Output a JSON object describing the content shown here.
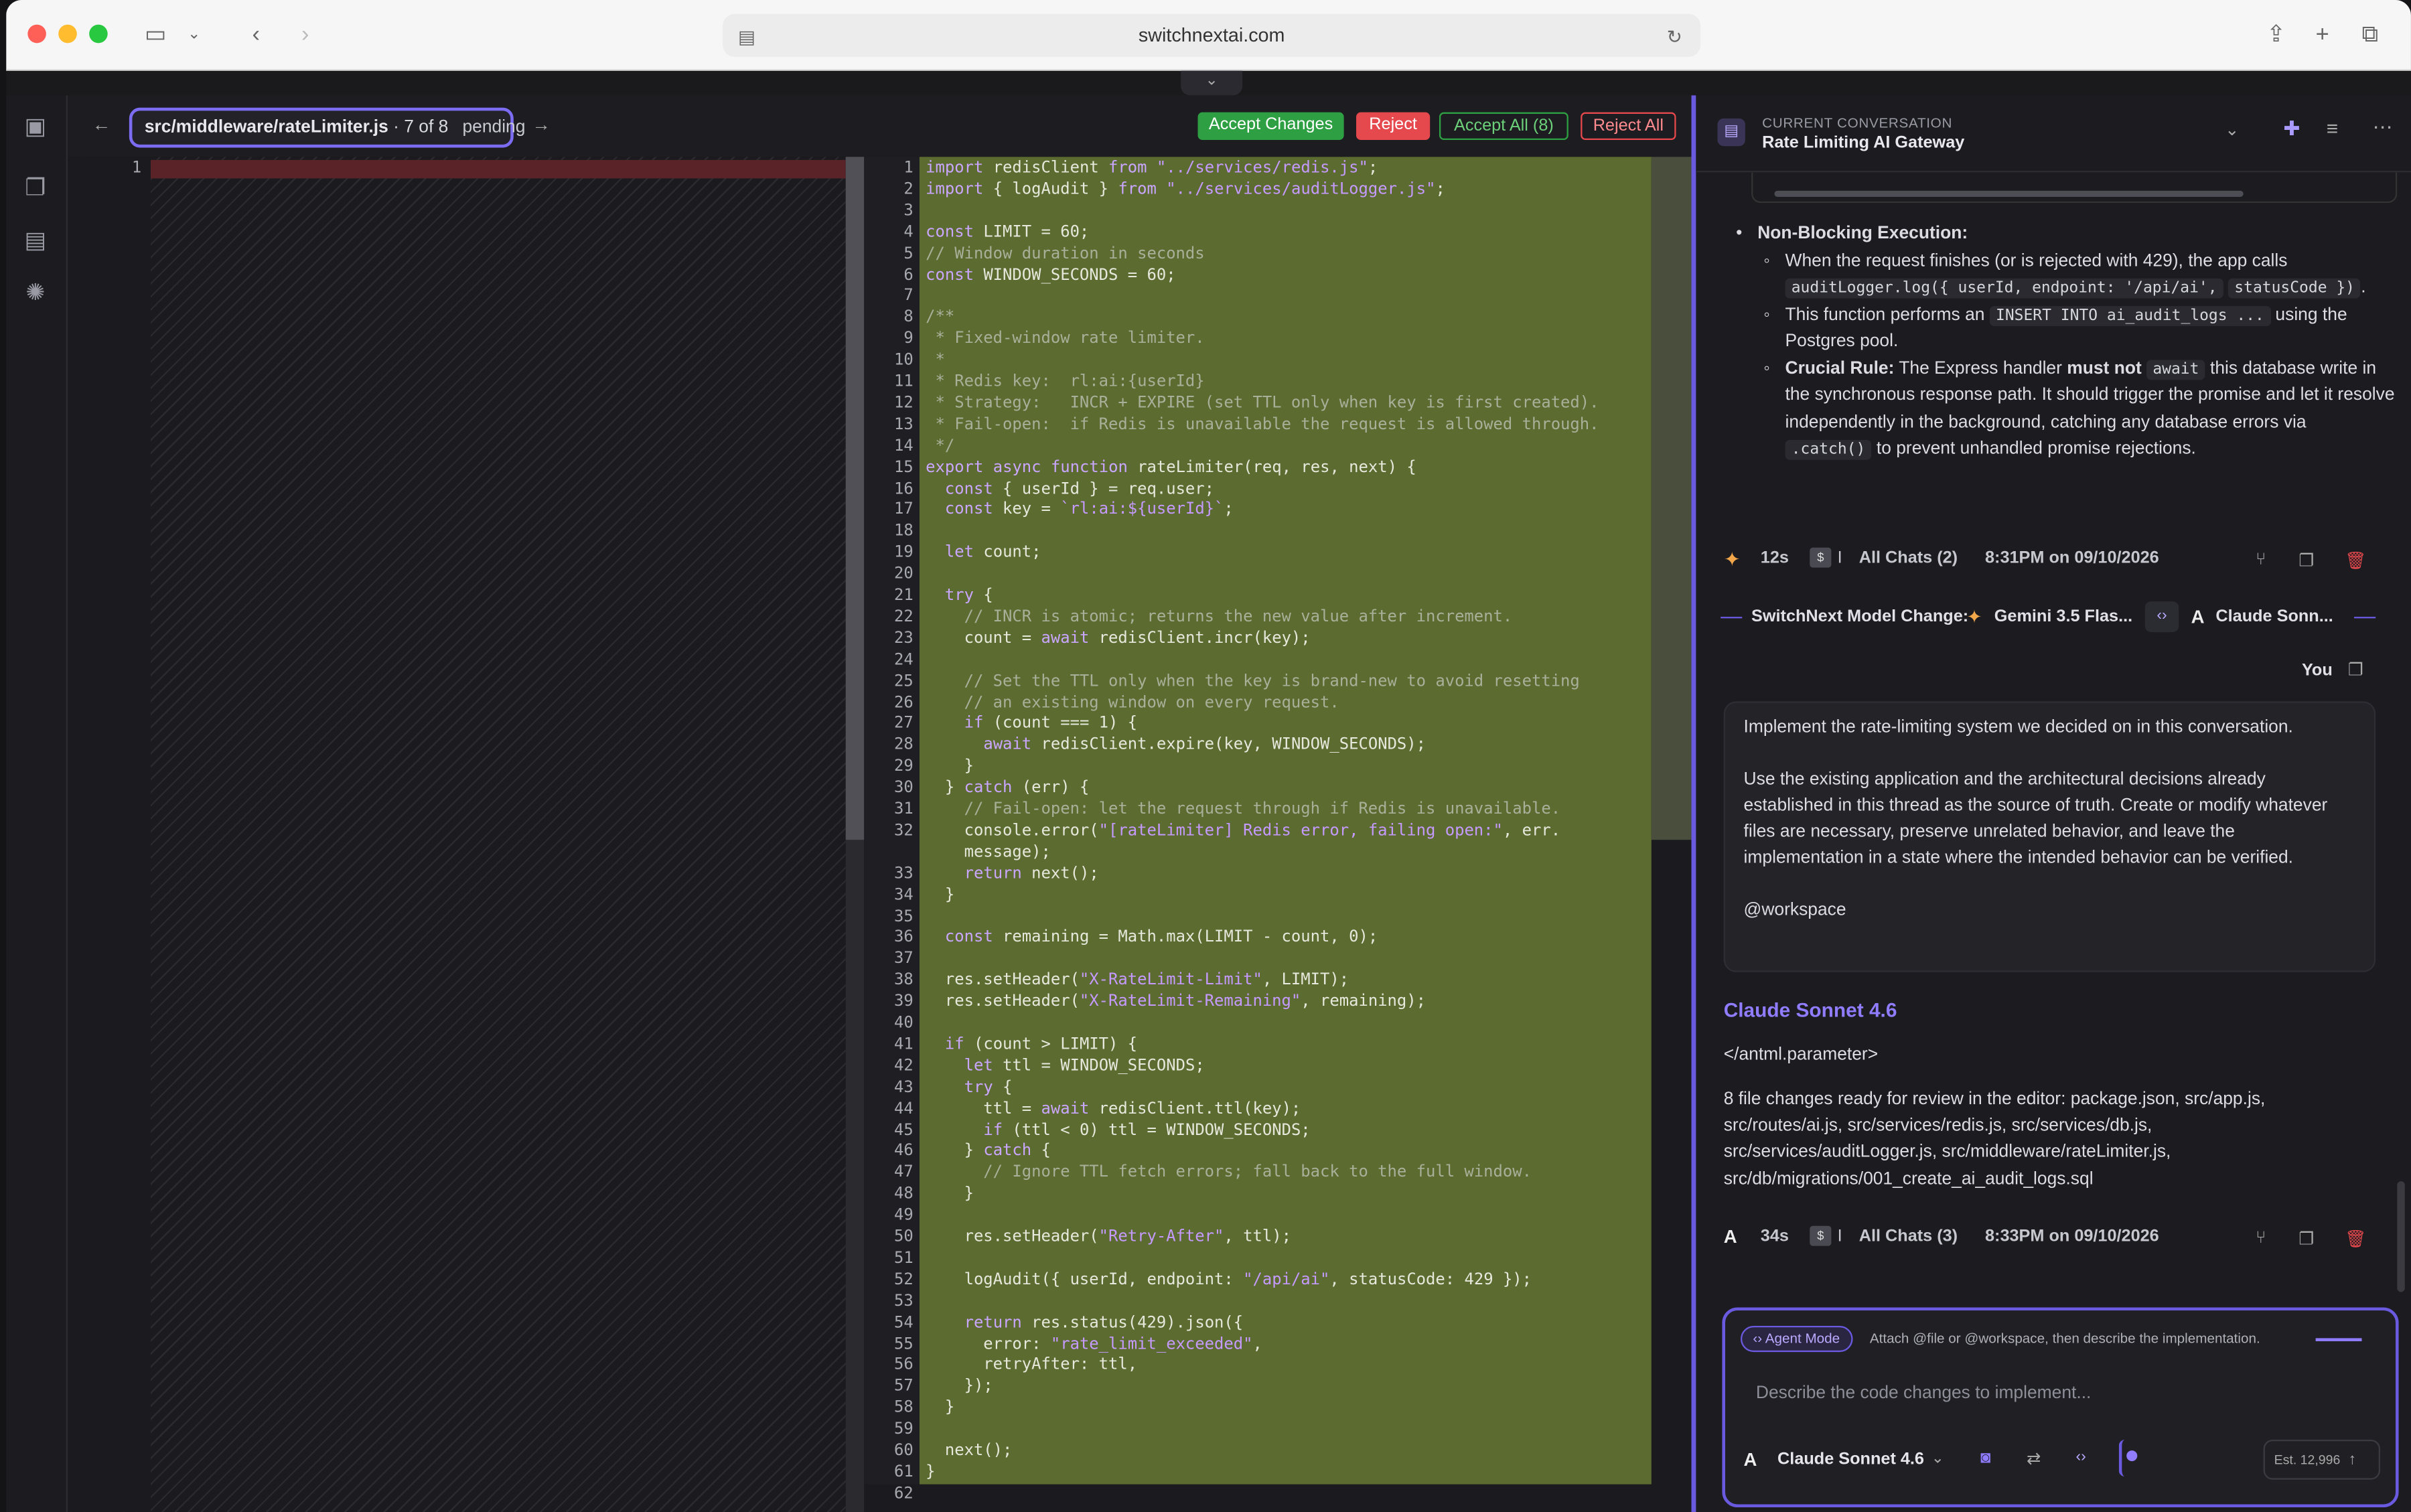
{
  "browser": {
    "url": "switchnextai.com"
  },
  "toolbar": {
    "file_path": "src/middleware/rateLimiter.js",
    "file_position": " · 7 of 8",
    "file_status": "pending",
    "accept_changes": "Accept Changes",
    "reject": "Reject",
    "accept_all": "Accept All (8)",
    "reject_all": "Reject All"
  },
  "left_pane": {
    "line_number": "1"
  },
  "code_lines": [
    "import redisClient from \"../services/redis.js\";",
    "import { logAudit } from \"../services/auditLogger.js\";",
    "",
    "const LIMIT = 60;",
    "// Window duration in seconds",
    "const WINDOW_SECONDS = 60;",
    "",
    "/**",
    " * Fixed-window rate limiter.",
    " *",
    " * Redis key:  rl:ai:{userId}",
    " * Strategy:   INCR + EXPIRE (set TTL only when key is first created).",
    " * Fail-open:  if Redis is unavailable the request is allowed through.",
    " */",
    "export async function rateLimiter(req, res, next) {",
    "  const { userId } = req.user;",
    "  const key = `rl:ai:${userId}`;",
    "",
    "  let count;",
    "",
    "  try {",
    "    // INCR is atomic; returns the new value after increment.",
    "    count = await redisClient.incr(key);",
    "",
    "    // Set the TTL only when the key is brand-new to avoid resetting",
    "    // an existing window on every request.",
    "    if (count === 1) {",
    "      await redisClient.expire(key, WINDOW_SECONDS);",
    "    }",
    "  } catch (err) {",
    "    // Fail-open: let the request through if Redis is unavailable.",
    "    console.error(\"[rateLimiter] Redis error, failing open:\", err.",
    "    message);",
    "    return next();",
    "  }",
    "",
    "  const remaining = Math.max(LIMIT - count, 0);",
    "",
    "  res.setHeader(\"X-RateLimit-Limit\", LIMIT);",
    "  res.setHeader(\"X-RateLimit-Remaining\", remaining);",
    "",
    "  if (count > LIMIT) {",
    "    let ttl = WINDOW_SECONDS;",
    "    try {",
    "      ttl = await redisClient.ttl(key);",
    "      if (ttl < 0) ttl = WINDOW_SECONDS;",
    "    } catch {",
    "      // Ignore TTL fetch errors; fall back to the full window.",
    "    }",
    "",
    "    res.setHeader(\"Retry-After\", ttl);",
    "",
    "    logAudit({ userId, endpoint: \"/api/ai\", statusCode: 429 });",
    "",
    "    return res.status(429).json({",
    "      error: \"rate_limit_exceeded\",",
    "      retryAfter: ttl,",
    "    });",
    "  }",
    "",
    "  next();",
    "}",
    ""
  ],
  "line_numbers": [
    "1",
    "2",
    "3",
    "4",
    "5",
    "6",
    "7",
    "8",
    "9",
    "10",
    "11",
    "12",
    "13",
    "14",
    "15",
    "16",
    "17",
    "18",
    "19",
    "20",
    "21",
    "22",
    "23",
    "24",
    "25",
    "26",
    "27",
    "28",
    "29",
    "30",
    "31",
    "32",
    "",
    "33",
    "34",
    "35",
    "36",
    "37",
    "38",
    "39",
    "40",
    "41",
    "42",
    "43",
    "44",
    "45",
    "46",
    "47",
    "48",
    "49",
    "50",
    "51",
    "52",
    "53",
    "54",
    "55",
    "56",
    "57",
    "58",
    "59",
    "60",
    "61",
    "62"
  ],
  "chat": {
    "header_label": "CURRENT CONVERSATION",
    "title": "Rate Limiting AI Gateway",
    "bullet_title": "Non-Blocking Execution:",
    "sub1a": "When the request finishes (or is rejected with 429), the app calls",
    "sub1_code": "auditLogger.log({ userId, endpoint: '/api/ai',",
    "sub1_code2": "statusCode })",
    "sub1_end": ".",
    "sub2a": "This function performs an",
    "sub2_code": "INSERT INTO ai_audit_logs ...",
    "sub2b": "using",
    "sub2c": "the Postgres pool.",
    "sub3_label": "Crucial Rule:",
    "sub3a": "The Express handler",
    "sub3_bold": "must not",
    "sub3_code": "await",
    "sub3b": "this database",
    "sub3c": "write in the synchronous response path. It should trigger the promise",
    "sub3d": "and let it resolve independently in the background, catching any",
    "sub3e": "database errors via",
    "sub3_code2": ".catch()",
    "sub3f": "to prevent unhandled promise",
    "sub3g": "rejections.",
    "meta1": {
      "time": "12s",
      "cost_sep": "I",
      "chats": "All Chats (2)",
      "date": "8:31PM on 09/10/2026"
    },
    "model_change_label": "SwitchNext Model Change:",
    "model_from": "Gemini 3.5 Flas...",
    "model_to": "Claude Sonn...",
    "you_label": "You",
    "user_msg": [
      "Implement the rate-limiting system we decided on in this conversation.",
      "Use the existing application and the architectural decisions already",
      "established in this thread as the source of truth. Create or modify whatever",
      "files are necessary, preserve unrelated behavior, and leave the",
      "implementation in a state where the intended behavior can be verified.",
      "@workspace"
    ],
    "assistant_name": "Claude Sonnet 4.6",
    "assistant_line1": "</antml.parameter>",
    "assistant_msg": [
      "8 file changes ready for review in the editor: package.json, src/app.js,",
      "src/routes/ai.js, src/services/redis.js, src/services/db.js,",
      "src/services/auditLogger.js, src/middleware/rateLimiter.js,",
      "src/db/migrations/001_create_ai_audit_logs.sql"
    ],
    "meta2": {
      "time": "34s",
      "cost_sep": "I",
      "chats": "All Chats (3)",
      "date": "8:33PM on 09/10/2026"
    },
    "agent_mode": "Agent Mode",
    "agent_hint": "Attach @file or @workspace, then describe the implementation.",
    "input_placeholder": "Describe the code changes to implement...",
    "model_select": "Claude Sonnet 4.6",
    "estimate": "Est. 12,996"
  },
  "icons": [
    "sidebar-icon",
    "back-icon",
    "forward-icon",
    "reload-icon",
    "share-icon",
    "new-tab-icon",
    "tabs-icon",
    "chat-icon",
    "files-icon",
    "notes-icon",
    "settings-icon",
    "gemini-icon",
    "anthropic-icon",
    "copy-icon",
    "trash-icon",
    "branch-icon"
  ],
  "colors": {
    "accent": "#6a5ae0",
    "accept": "#2ea043",
    "reject": "#e5484d",
    "added_bg": "#5c6b30",
    "removed_bg": "#5a2328"
  }
}
